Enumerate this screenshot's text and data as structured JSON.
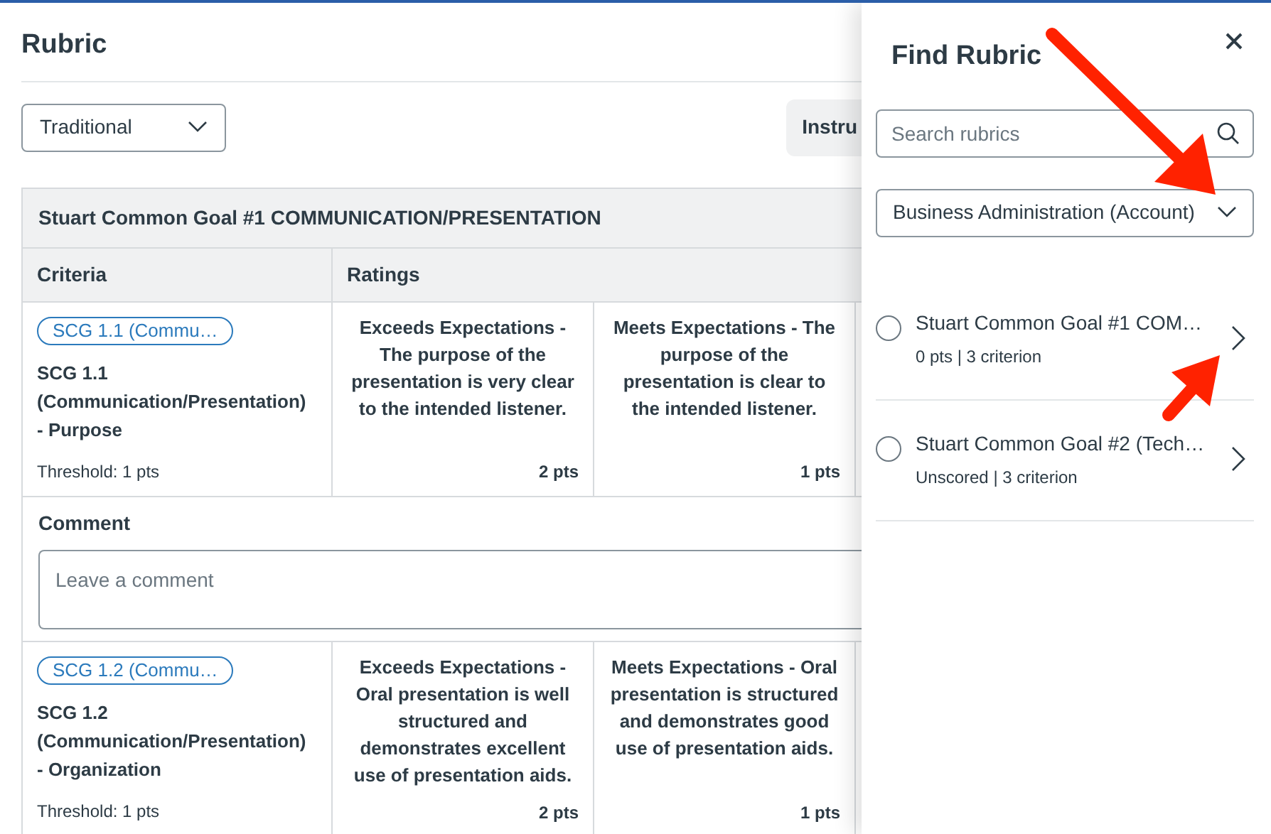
{
  "page_title": "Rubric",
  "view_select": {
    "value": "Traditional"
  },
  "instructor_button": {
    "label": "Instru"
  },
  "rubric": {
    "title": "Stuart Common Goal #1 COMMUNICATION/PRESENTATION",
    "columns": [
      "Criteria",
      "Ratings"
    ],
    "criteria": [
      {
        "tag": "SCG 1.1 (Commu…",
        "title": "SCG 1.1 (Communication/Presentation) - Purpose",
        "threshold": "Threshold: 1 pts",
        "ratings": [
          {
            "description": "Exceeds Expectations - The purpose of the presentation is very clear to the intended listener.",
            "points": "2 pts"
          },
          {
            "description": "Meets Expectations - The purpose of the presentation is clear to the intended listener.",
            "points": "1 pts"
          }
        ],
        "comment": {
          "label": "Comment",
          "placeholder": "Leave a comment"
        }
      },
      {
        "tag": "SCG 1.2 (Commu…",
        "title": "SCG 1.2 (Communication/Presentation) - Organization",
        "threshold": "Threshold: 1 pts",
        "ratings": [
          {
            "description": "Exceeds Expectations - Oral presentation is well structured and demonstrates excellent use of presentation aids.",
            "points": "2 pts"
          },
          {
            "description": "Meets Expectations - Oral presentation is structured and demonstrates good use of presentation aids.",
            "points": "1 pts"
          }
        ]
      }
    ]
  },
  "drawer": {
    "title": "Find Rubric",
    "search": {
      "placeholder": "Search rubrics"
    },
    "account_select": {
      "value": "Business Administration (Account)"
    },
    "results": [
      {
        "title": "Stuart Common Goal #1 COM…",
        "meta": "0 pts | 3 criterion",
        "selected": false
      },
      {
        "title": "Stuart Common Goal #2 (Tech…",
        "meta": "Unscored | 3 criterion",
        "selected": false
      }
    ]
  }
}
